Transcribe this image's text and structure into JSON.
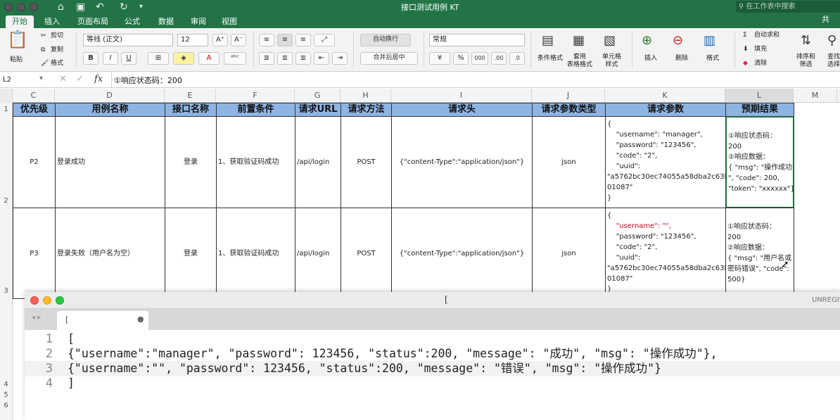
{
  "window": {
    "title": "接口测试用例 KT",
    "search_placeholder": "在工作表中搜索"
  },
  "ribbon_tabs": [
    "开始",
    "插入",
    "页面布局",
    "公式",
    "数据",
    "审阅",
    "视图"
  ],
  "ribbon": {
    "paste": "粘贴",
    "cut": "剪切",
    "copy": "复制",
    "format": "格式",
    "font_name": "等线 (正文)",
    "font_size": "12",
    "bold": "B",
    "italic": "I",
    "underline": "U",
    "wrap_text": "自动换行",
    "merge_center": "合并后居中",
    "number_format": "常规",
    "percent": "%",
    "thousands": "000",
    "conditional_format": "条件格式",
    "table_format": "套用\n表格格式",
    "cell_style": "单元格\n样式",
    "insert": "插入",
    "delete": "删除",
    "format_cells": "格式",
    "autosum": "自动求和",
    "fill": "填充",
    "clear": "清除",
    "sort_filter": "排序和\n筛选",
    "find_select": "查找\n选择",
    "share": "共"
  },
  "formula_bar": {
    "cell_ref": "L2",
    "fx": "fx",
    "content": "①响应状态码：200"
  },
  "columns": [
    "C",
    "D",
    "E",
    "F",
    "G",
    "H",
    "I",
    "J",
    "K",
    "L",
    "M"
  ],
  "rows": [
    "1",
    "2",
    "3",
    "4",
    "5",
    "6"
  ],
  "header_row": [
    "优先级",
    "用例名称",
    "接口名称",
    "前置条件",
    "请求URL",
    "请求方法",
    "请求头",
    "请求参数类型",
    "请求参数",
    "预期结果"
  ],
  "data_rows": [
    {
      "priority": "P2",
      "case_name": "登录成功",
      "api_name": "登录",
      "precondition": "1、获取验证码成功",
      "url": "/api/login",
      "method": "POST",
      "headers": "{\"content-Type\":\"application/json\"}",
      "param_type": "json",
      "params_l1": "{",
      "params_l2": "    \"username\": \"manager\",",
      "params_l3": "    \"password\": \"123456\",",
      "params_l4": "    \"code\": \"2\",",
      "params_l5": "    \"uuid\":",
      "params_l6": "\"a5762bc30ec74055a58dba2c63b",
      "params_l7": "01087\"",
      "params_l8": "}",
      "expected_l1": "①响应状态码：",
      "expected_l2": "200",
      "expected_l3": "②响应数据：",
      "expected_l4": "{ \"msg\": \"操作成功",
      "expected_l5": "\", \"code\": 200,",
      "expected_l6": "\"token\": \"xxxxxx\"}"
    },
    {
      "priority": "P3",
      "case_name": "登录失败（用户名为空）",
      "api_name": "登录",
      "precondition": "1、获取验证码成功",
      "url": "/api/login",
      "method": "POST",
      "headers": "{\"content-Type\":\"application/json\"}",
      "param_type": "json",
      "params_l1": "{",
      "params_l2": "    \"username\": \"\",",
      "params_l3": "    \"password\": \"123456\",",
      "params_l4": "    \"code\": \"2\",",
      "params_l5": "    \"uuid\":",
      "params_l6": "\"a5762bc30ec74055a58dba2c63b",
      "params_l7": "01087\"",
      "params_l8": "}",
      "expected_l1": "①响应状态码：",
      "expected_l2": "200",
      "expected_l3": "②响应数据：",
      "expected_l4": "{ \"msg\": \"用户名或",
      "expected_l5": "密码错误\", \"code\":",
      "expected_l6": "500}"
    }
  ],
  "editor": {
    "title": "[",
    "tab_label": "[",
    "unregistered": "UNREGIS",
    "line_numbers": [
      "1",
      "2",
      "3",
      "4"
    ],
    "lines": [
      "[",
      "{\"username\":\"manager\", \"password\": 123456, \"status\":200, \"message\": \"成功\", \"msg\": \"操作成功\"},",
      "{\"username\":\"\", \"password\": 123456, \"status\":200, \"message\": \"错误\", \"msg\": \"操作成功\"}",
      "]"
    ]
  },
  "colors": {
    "excel_green": "#227447",
    "header_fill": "#8eb4e3",
    "empty_username_red": "#d0021b"
  }
}
